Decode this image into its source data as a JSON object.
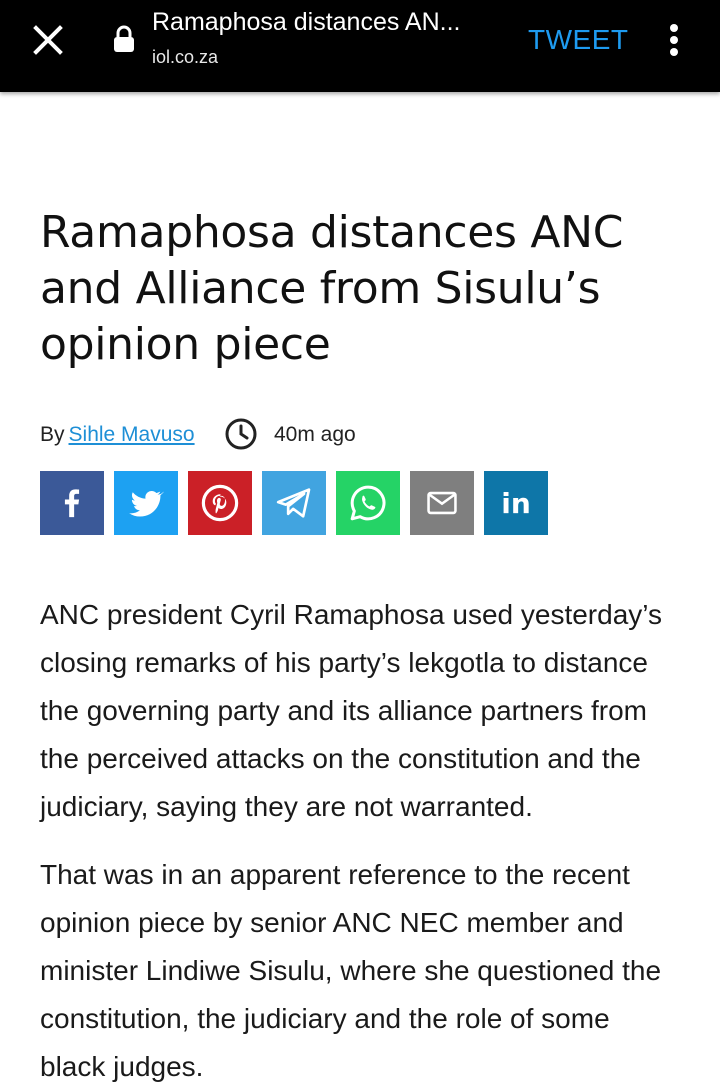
{
  "browser": {
    "page_title": "Ramaphosa distances AN...",
    "url": "iol.co.za",
    "tweet_label": "TWEET",
    "icons": {
      "close": "close-icon",
      "lock": "lock-icon",
      "menu": "more-vert-icon"
    }
  },
  "article": {
    "headline": "Ramaphosa distances ANC and Alliance from Sisulu’s opinion piece",
    "by_label": "By",
    "author": "Sihle Mavuso",
    "time_ago": "40m ago",
    "share_buttons": [
      {
        "name": "facebook",
        "color": "#3b5998"
      },
      {
        "name": "twitter",
        "color": "#1da1f2"
      },
      {
        "name": "pinterest",
        "color": "#cb2027"
      },
      {
        "name": "telegram",
        "color": "#41a4e0"
      },
      {
        "name": "whatsapp",
        "color": "#25d366"
      },
      {
        "name": "email",
        "color": "#7f7f7f"
      },
      {
        "name": "linkedin",
        "color": "#0e76a8",
        "label": "in"
      }
    ],
    "paragraphs": [
      "ANC president Cyril Ramaphosa used yesterday’s closing remarks of his party’s lekgotla to distance the governing party and its alliance partners from the perceived attacks on the constitution and the judiciary, saying they are not warranted.",
      "That was in an apparent reference to the recent opinion piece by senior ANC NEC member and minister Lindiwe Sisulu, where she questioned the constitution, the judiciary and the role of some black judges."
    ]
  }
}
